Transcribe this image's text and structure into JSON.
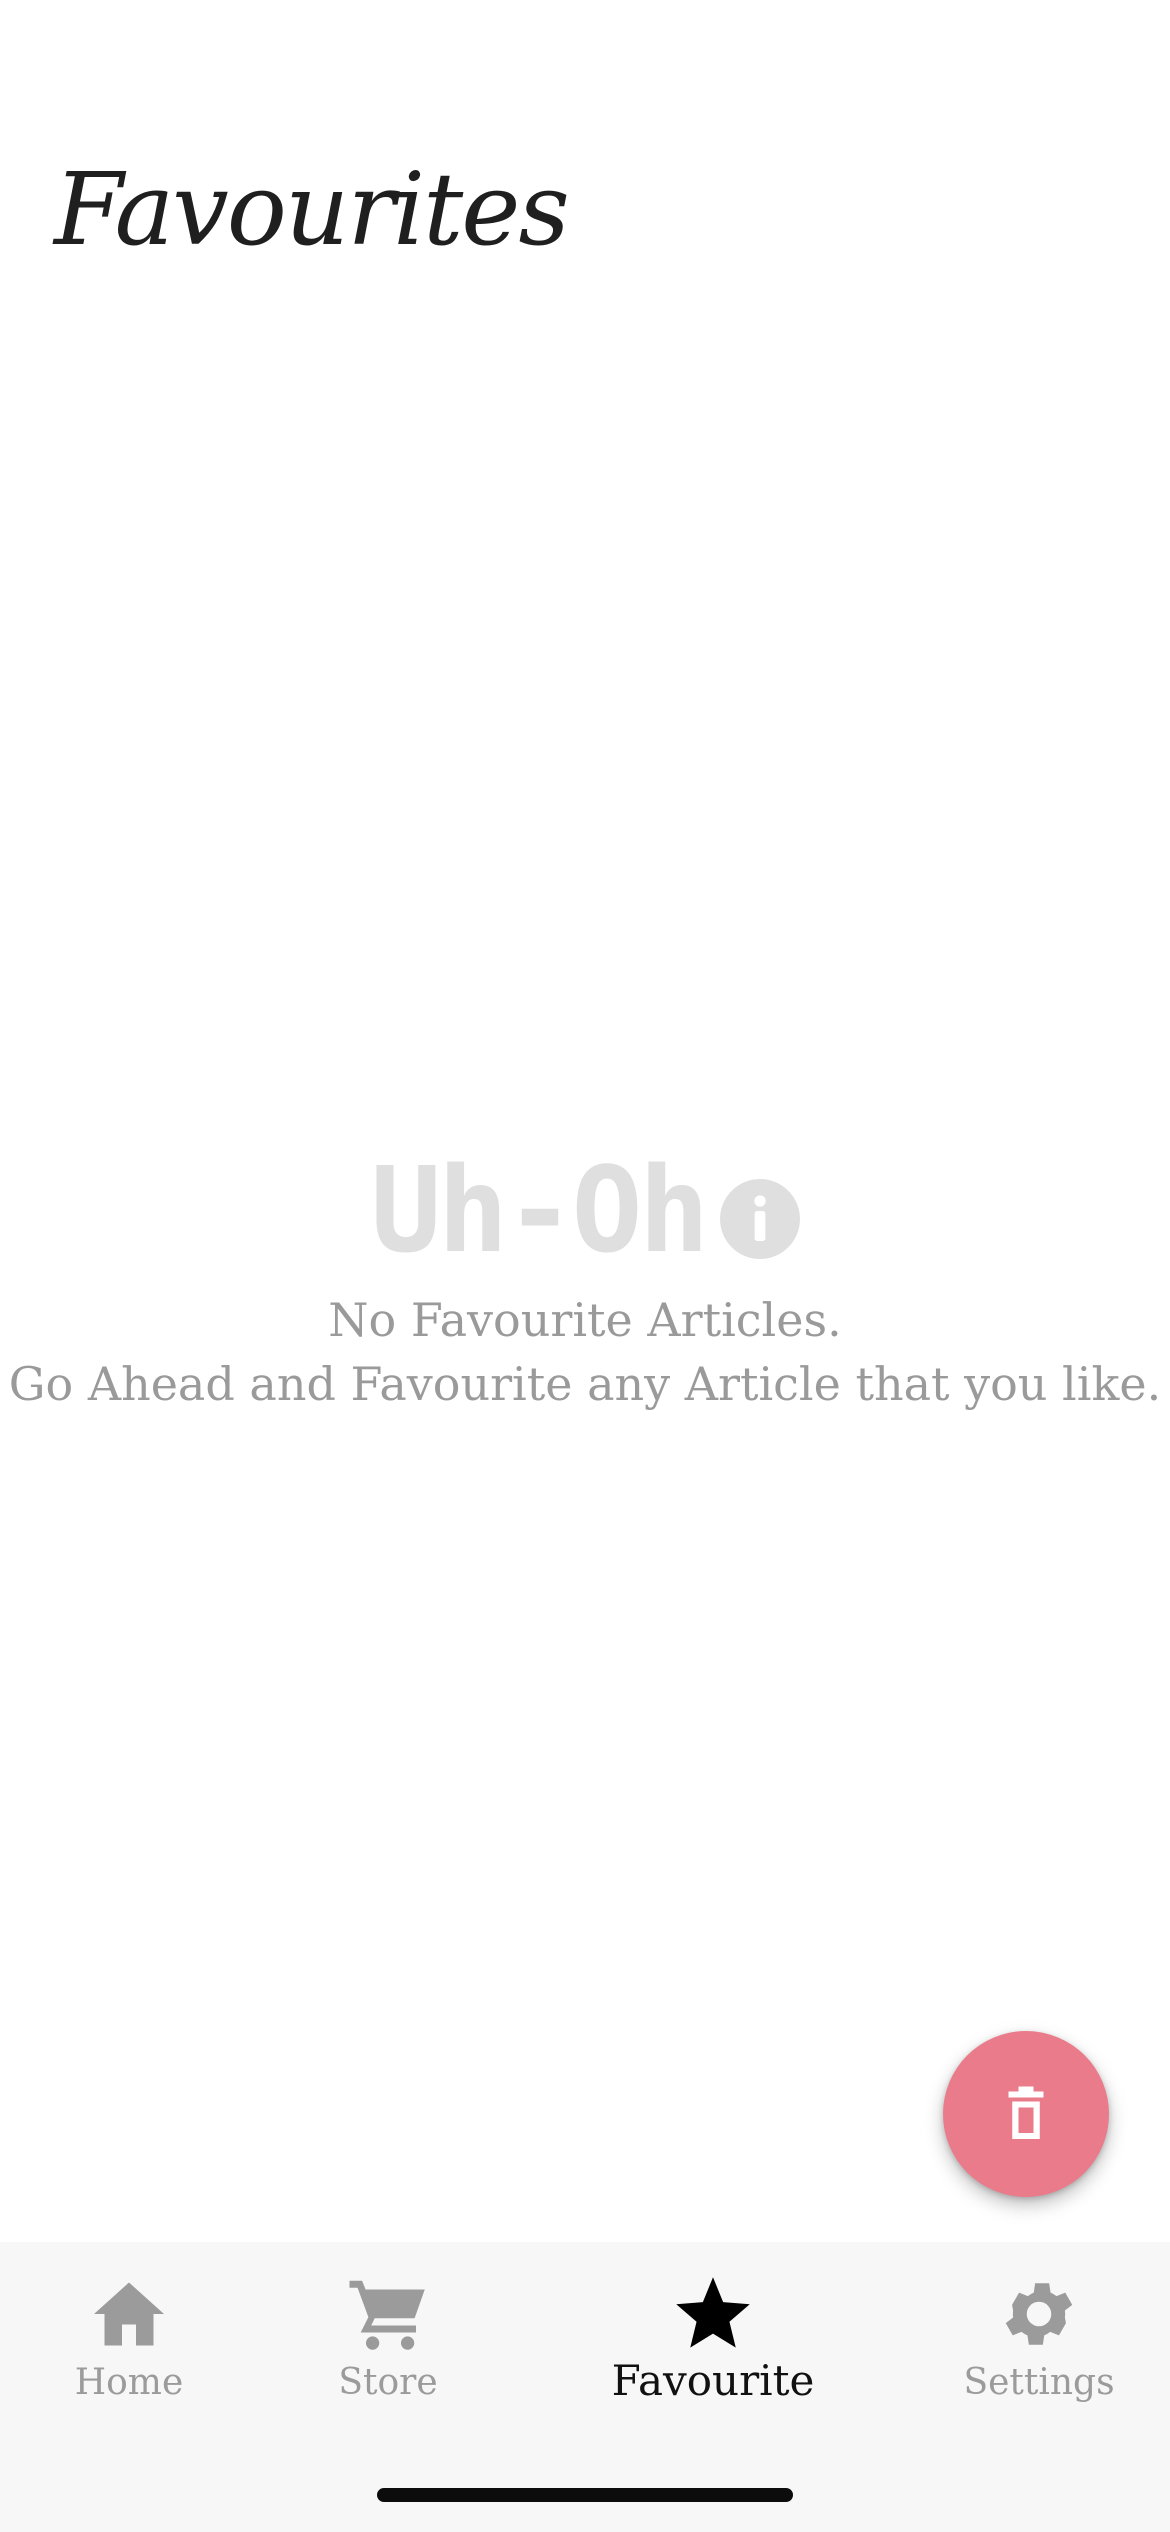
{
  "header": {
    "title": "Favourites"
  },
  "empty_state": {
    "heading": "Uh-Oh",
    "heading_icon": "info-circle-icon",
    "line1": "No Favourite Articles.",
    "line2": "Go Ahead and Favourite any Article that you like."
  },
  "fab": {
    "icon": "trash-icon",
    "color": "#e97b8a"
  },
  "bottom_nav": {
    "active": "Favourite",
    "items": [
      {
        "label": "Home",
        "icon": "home-icon"
      },
      {
        "label": "Store",
        "icon": "cart-icon"
      },
      {
        "label": "Favourite",
        "icon": "star-icon"
      },
      {
        "label": "Settings",
        "icon": "gear-icon"
      }
    ]
  },
  "colors": {
    "inactive": "#9b9b9b",
    "active": "#111111",
    "nav_background": "#f7f7f7"
  }
}
